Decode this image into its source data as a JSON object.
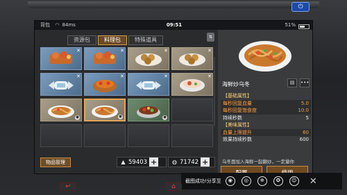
{
  "status_bar": {
    "network": "背包",
    "speed": "84ms",
    "time": "09:51",
    "battery": "51%"
  },
  "tabs": [
    {
      "label": "资源包",
      "active": false
    },
    {
      "label": "料理包",
      "active": true
    },
    {
      "label": "特殊道具",
      "active": false
    }
  ],
  "grid_items": [
    {
      "name": "seafood-tray",
      "color": "blue",
      "badge": "x"
    },
    {
      "name": "seafood-tray",
      "color": "blue",
      "badge": "x"
    },
    {
      "name": "cookie-plate",
      "color": "tan",
      "badge": "x"
    },
    {
      "name": "cookie-plate",
      "color": "tan",
      "badge": "x"
    },
    {
      "name": "candy-wrap",
      "color": "blue",
      "badge": "x"
    },
    {
      "name": "fruit-tart",
      "color": "blue",
      "badge": "x"
    },
    {
      "name": "candy-wrap",
      "color": "blue",
      "badge": "x"
    },
    {
      "name": "soup-bowl",
      "color": "tan",
      "badge": "x"
    },
    {
      "name": "noodle-plate",
      "color": "tan",
      "badge": "count"
    },
    {
      "name": "noodle-plate",
      "color": "tan",
      "badge": "count",
      "selected": true
    },
    {
      "name": "stew-pot",
      "color": "green",
      "badge": "count"
    },
    {
      "name": "empty",
      "color": "plain"
    },
    {
      "name": "empty",
      "color": "plain"
    },
    {
      "name": "empty",
      "color": "plain"
    },
    {
      "name": "empty",
      "color": "plain"
    },
    {
      "name": "empty",
      "color": "plain"
    }
  ],
  "manage_button": "物品管理",
  "currency": [
    {
      "icon": "silver-icon",
      "value": "59403"
    },
    {
      "icon": "gem-icon",
      "value": "71742"
    }
  ],
  "detail": {
    "title": "海鲜炒乌冬",
    "sections": [
      {
        "type": "header",
        "label": "【基础属性】"
      },
      {
        "type": "row",
        "label": "每秒回复血量",
        "value": "5.0",
        "highlight": true,
        "label_color": "orange",
        "value_color": "orange"
      },
      {
        "type": "row",
        "label": "每秒回复饱食度",
        "value": "10.0",
        "highlight": true,
        "label_color": "orange",
        "value_color": "orange"
      },
      {
        "type": "row",
        "label": "持续秒数",
        "value": "5",
        "highlight": false,
        "label_color": "white",
        "value_color": "white"
      },
      {
        "type": "header",
        "label": "【美味属性】"
      },
      {
        "type": "row",
        "label": "血量上限提升",
        "value": "60",
        "highlight": true,
        "label_color": "orange",
        "value_color": "orange"
      },
      {
        "type": "row",
        "label": "效果持续秒数",
        "value": "600",
        "highlight": false,
        "label_color": "white",
        "value_color": "white"
      }
    ],
    "description": "乌冬面加入海鲜一起翻炒，一定量你",
    "buttons": {
      "left": "配置",
      "right": "使用"
    }
  },
  "share": {
    "label": "截图成功!分享至",
    "icons": [
      "weibo-icon",
      "wechat-icon",
      "moments-icon",
      "qzone-icon",
      "qq-icon"
    ]
  }
}
